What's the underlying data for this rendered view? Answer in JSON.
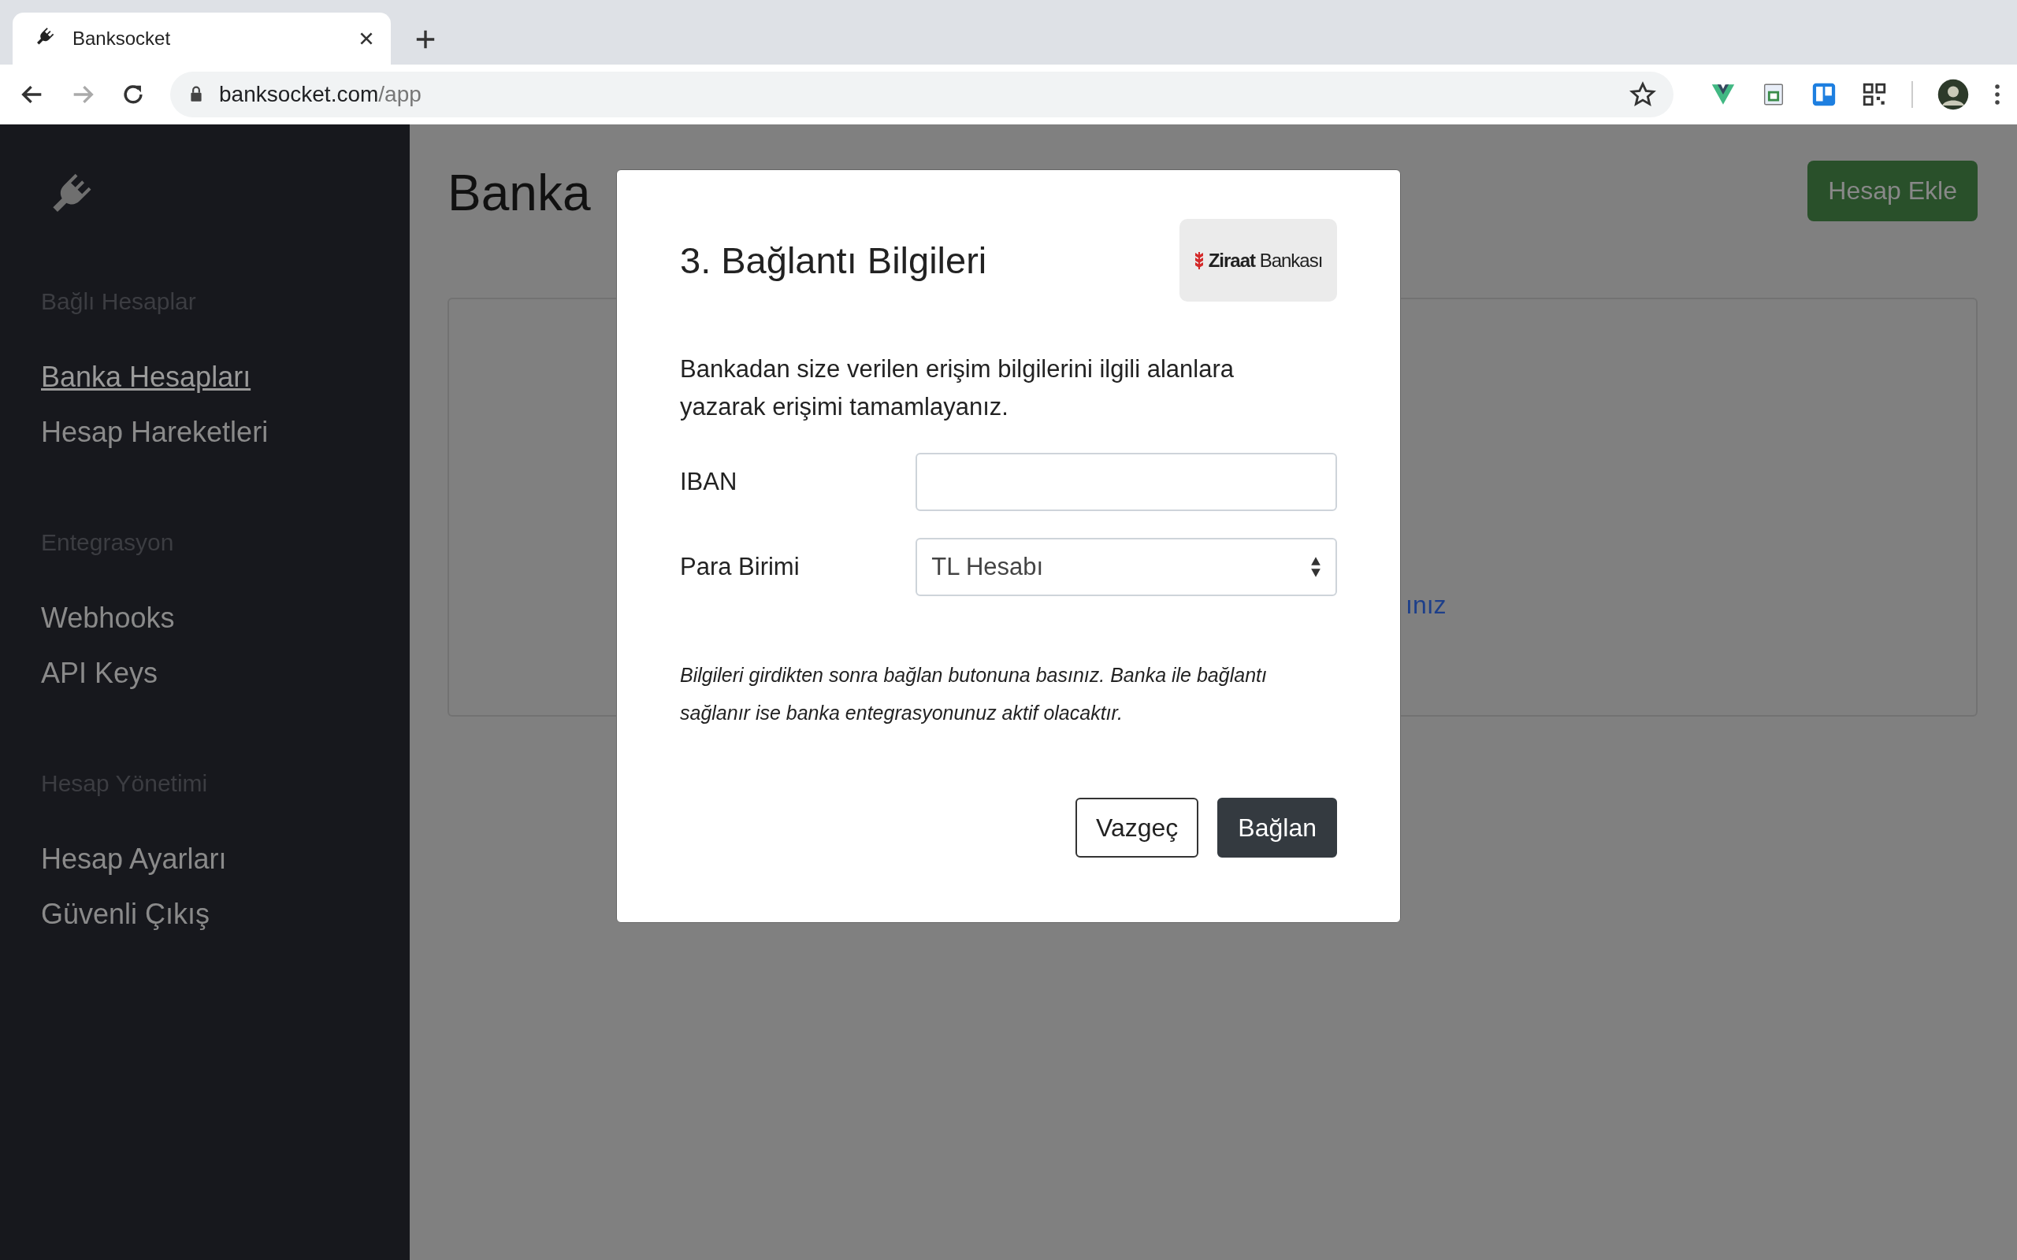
{
  "browser": {
    "tab": {
      "title": "Banksocket"
    },
    "url": {
      "host": "banksocket.com",
      "path": "/app"
    }
  },
  "sidebar": {
    "sections": [
      {
        "heading": "Bağlı Hesaplar",
        "items": [
          {
            "label": "Banka Hesapları",
            "selected": true
          },
          {
            "label": "Hesap Hareketleri",
            "selected": false
          }
        ]
      },
      {
        "heading": "Entegrasyon",
        "items": [
          {
            "label": "Webhooks",
            "selected": false
          },
          {
            "label": "API Keys",
            "selected": false
          }
        ]
      },
      {
        "heading": "Hesap Yönetimi",
        "items": [
          {
            "label": "Hesap Ayarları",
            "selected": false
          },
          {
            "label": "Güvenli Çıkış",
            "selected": false
          }
        ]
      }
    ]
  },
  "page": {
    "title": "Banka",
    "add_button": "Hesap Ekle",
    "card_link": "ınız"
  },
  "modal": {
    "title": "3. Bağlantı Bilgileri",
    "bank_logo": {
      "name": "Ziraat",
      "suffix": "Bankası"
    },
    "description": "Bankadan size verilen erişim bilgilerini ilgili alanlara yazarak erişimi tamamlayanız.",
    "fields": [
      {
        "label": "IBAN",
        "kind": "input"
      },
      {
        "label": "Para Birimi",
        "kind": "select",
        "value": "TL Hesabı"
      }
    ],
    "note": "Bilgileri girdikten sonra bağlan butonuna basınız. Banka ile bağlantı sağlanır ise banka entegrasyonunuz aktif olacaktır.",
    "buttons": [
      {
        "label": "Vazgeç",
        "kind": "secondary"
      },
      {
        "label": "Bağlan",
        "kind": "primary"
      }
    ]
  }
}
